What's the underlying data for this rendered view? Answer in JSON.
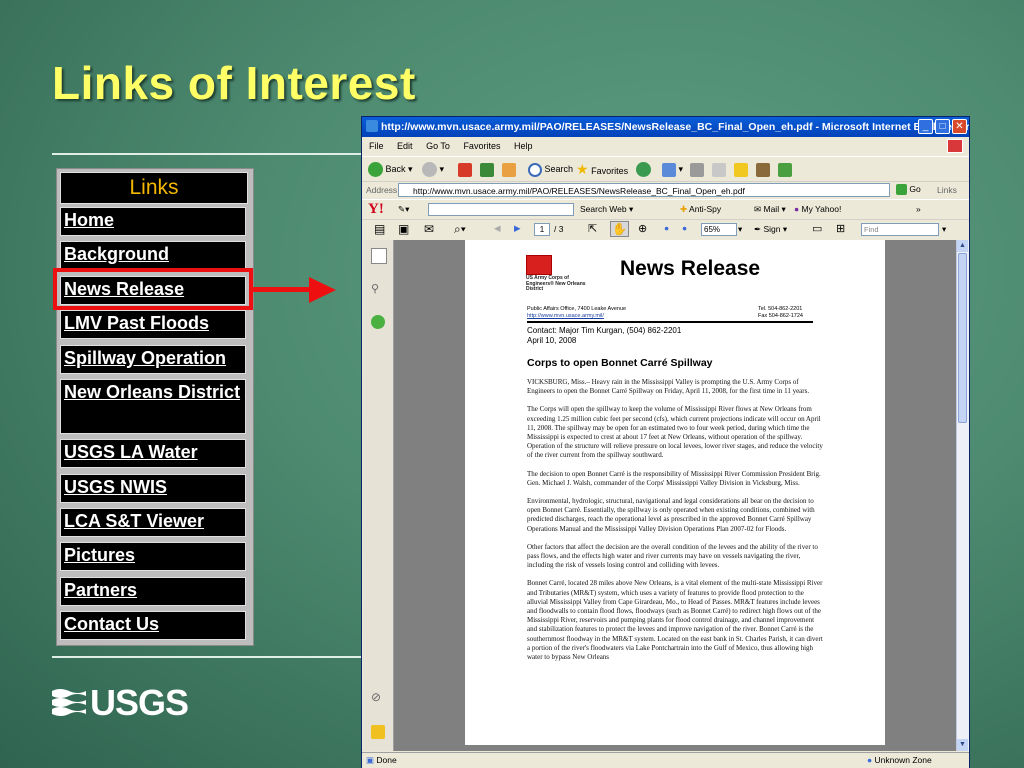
{
  "slide": {
    "title": "Links of Interest",
    "logo_text": "USGS"
  },
  "links": {
    "header": "Links",
    "items": [
      "Home",
      "Background",
      "News Release",
      "LMV Past Floods",
      "Spillway Operation",
      "New Orleans District",
      "USGS LA Water",
      "USGS NWIS",
      "LCA S&T Viewer",
      "Pictures",
      "Partners",
      "Contact Us"
    ],
    "highlighted": "News Release"
  },
  "browser": {
    "title": "http://www.mvn.usace.army.mil/PAO/RELEASES/NewsRelease_BC_Final_Open_eh.pdf - Microsoft Internet Explorer provide...",
    "menu": [
      "File",
      "Edit",
      "Go To",
      "Favorites",
      "Help"
    ],
    "toolbar": {
      "back": "Back",
      "search": "Search",
      "favorites": "Favorites"
    },
    "address": {
      "label": "Address",
      "url": "http://www.mvn.usace.army.mil/PAO/RELEASES/NewsRelease_BC_Final_Open_eh.pdf",
      "go": "Go",
      "links": "Links"
    },
    "yahoo_bar": {
      "logo": "Y!",
      "search_web": "Search Web",
      "anti_spy": "Anti-Spy",
      "mail": "Mail",
      "my_yahoo": "My Yahoo!"
    },
    "pdf_toolbar": {
      "page_current": "1",
      "page_total": "/ 3",
      "zoom": "65%",
      "sign": "Sign",
      "find_placeholder": "Find"
    },
    "status": {
      "left": "Done",
      "right": "Unknown Zone"
    },
    "accent": "#0a5ed8"
  },
  "document": {
    "org_name": "US Army Corps of Engineers® New Orleans District",
    "heading": "News Release",
    "office": "Public Affairs Office, 7400 Leake Avenue",
    "office_url": "http://www.mvn.usace.army.mil/",
    "tel": "Tel. 504-862-2201",
    "fax": "Fax 504-862-1724",
    "contact": "Contact: Major Tim Kurgan, (504) 862-2201",
    "date": "April 10, 2008",
    "headline": "Corps to open Bonnet Carré Spillway",
    "paragraphs": [
      "VICKSBURG, Miss.– Heavy rain in the Mississippi Valley is prompting the U.S. Army Corps of Engineers to open the Bonnet Carré Spillway on Friday, April 11, 2008, for the first time in 11 years.",
      "The Corps will open the spillway to keep the volume of Mississippi River flows at New Orleans from exceeding 1.25 million cubic feet per second (cfs), which current projections indicate will occur on April 11, 2008. The spillway may be open for an estimated two to four week period, during which time the Mississippi is expected to crest at about 17 feet at New Orleans, without operation of the spillway. Operation of the structure will relieve pressure on local levees, lower river stages, and reduce the velocity of the river current from the spillway southward.",
      "The decision to open Bonnet Carré is the responsibility of Mississippi River Commission President Brig. Gen. Michael J. Walsh, commander of the Corps' Mississippi Valley Division in Vicksburg, Miss.",
      "Environmental, hydrologic, structural, navigational and legal considerations all bear on the decision to open Bonnet Carré. Essentially, the spillway is only operated when existing conditions, combined with predicted discharges, reach the operational level as prescribed in the approved Bonnet Carré Spillway Operations Manual and the Mississippi Valley Division Operations Plan 2007-02 for Floods.",
      "Other factors that affect the decision are the overall condition of the levees and the ability of the river to pass flows, and the effects high water and river currents may have on vessels navigating the river, including the risk of vessels losing control and colliding with levees.",
      "Bonnet Carré, located 28 miles above New Orleans, is a vital element of the multi-state Mississippi River and Tributaries (MR&T) system, which uses a variety of features to provide flood protection to the alluvial Mississippi Valley from Cape Girardeau, Mo., to Head of Passes. MR&T features include levees and floodwalls to contain flood flows, floodways (such as Bonnet Carré) to redirect high flows out of the Mississippi River, reservoirs and pumping plants for flood control drainage, and channel improvement and stabilization features to protect the levees and improve navigation of the river. Bonnet Carré is the southernmost floodway in the MR&T system. Located on the east bank in St. Charles Parish, it can divert a portion of the river's floodwaters via Lake Pontchartrain into the Gulf of Mexico, thus allowing high water to bypass New Orleans"
    ]
  }
}
